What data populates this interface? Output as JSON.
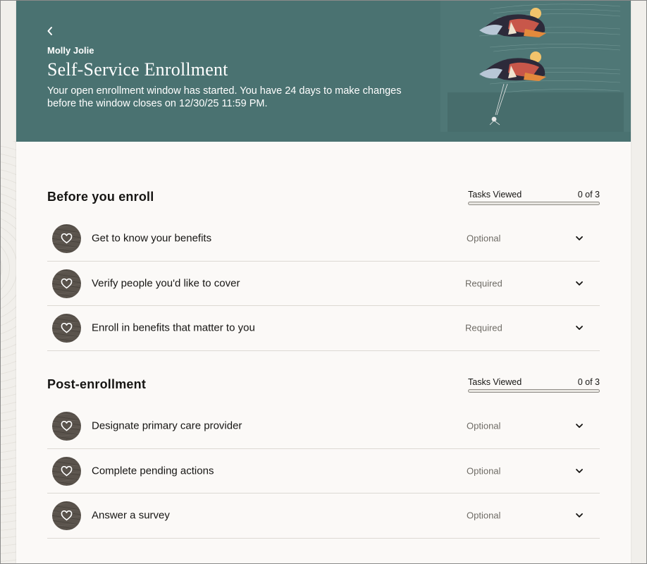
{
  "hero": {
    "name": "Molly Jolie",
    "title": "Self-Service Enrollment",
    "description": "Your open enrollment window has started. You have 24 days to make changes before the window closes on 12/30/25 11:59 PM.",
    "background_color": "#4a7271"
  },
  "sections": [
    {
      "title": "Before you enroll",
      "progress": {
        "label": "Tasks Viewed",
        "count_text": "0 of 3",
        "viewed": 0,
        "total": 3
      },
      "items": [
        {
          "label": "Get to know your benefits",
          "status": "Optional",
          "icon": "heart-icon"
        },
        {
          "label": "Verify people you'd like to cover",
          "status": "Required",
          "icon": "heart-icon"
        },
        {
          "label": "Enroll in benefits that matter to you",
          "status": "Required",
          "icon": "heart-icon"
        }
      ]
    },
    {
      "title": "Post-enrollment",
      "progress": {
        "label": "Tasks Viewed",
        "count_text": "0 of 3",
        "viewed": 0,
        "total": 3
      },
      "items": [
        {
          "label": "Designate primary care provider",
          "status": "Optional",
          "icon": "heart-icon"
        },
        {
          "label": "Complete pending actions",
          "status": "Optional",
          "icon": "heart-icon"
        },
        {
          "label": "Answer a survey",
          "status": "Optional",
          "icon": "heart-icon"
        }
      ]
    }
  ]
}
